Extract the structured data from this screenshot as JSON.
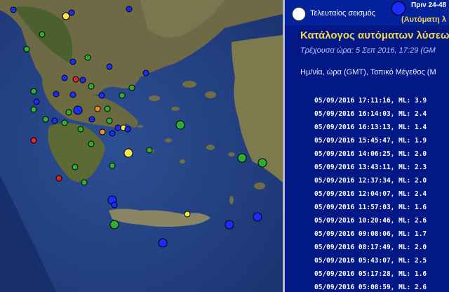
{
  "legend": {
    "last_quake_label": "Τελευταίος σεισμός",
    "blue_label": "Πριν 24-48",
    "automatic_label": "(Αυτόματη λ"
  },
  "panel": {
    "title": "Κατάλογος αυτόματων λύσεω",
    "current_time": "Τρέχουσα ώρα: 5 Σεπ 2016, 17:29 (GM",
    "column_header": "Ημ/νία, ώρα (GMT), Τοπικό Μέγεθος (Μ"
  },
  "quakes": [
    "05/09/2016 17:11:16,  ML: 3.9",
    "05/09/2016 16:14:03,  ML: 2.4",
    "05/09/2016 16:13:13,  ML: 1.4",
    "05/09/2016 15:45:47,  ML: 1.9",
    "05/09/2016 14:06:25,  ML: 2.0",
    "05/09/2016 13:43:11,  ML: 2.3",
    "05/09/2016 12:37:34,  ML: 2.0",
    "05/09/2016 12:04:07,  ML: 2.4",
    "05/09/2016 11:57:03,  ML: 1.6",
    "05/09/2016 10:20:46,  ML: 2.6",
    "05/09/2016 09:08:06,  ML: 1.7",
    "05/09/2016 08:17:49,  ML: 2.0",
    "05/09/2016 05:43:07,  ML: 2.5",
    "05/09/2016 05:17:28,  ML: 1.6",
    "05/09/2016 05:08:59,  ML: 2.6"
  ],
  "colors": {
    "panel_bg": "#031887",
    "title": "#f4d44a",
    "marker_yellow": "#f5e84a",
    "marker_red": "#e3261f",
    "marker_orange": "#f08a2c",
    "marker_green": "#2fae33",
    "marker_blue": "#1b2cff",
    "marker_white": "#ffffff"
  }
}
